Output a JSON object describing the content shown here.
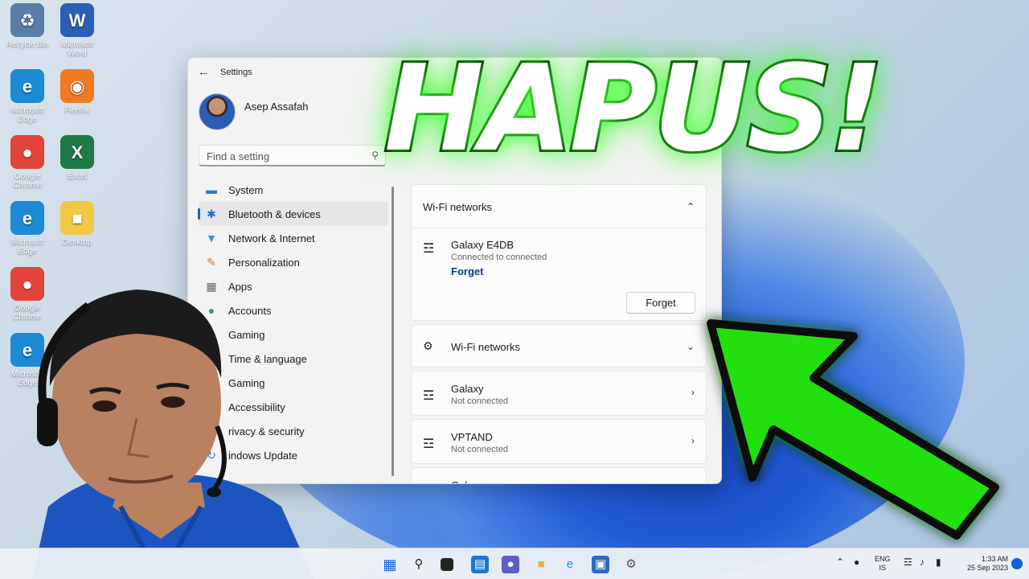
{
  "caption": "HAPUS!",
  "desktop": {
    "icons": [
      {
        "label": "Recycle Bin",
        "color": "#5a7da8",
        "glyph": "♻"
      },
      {
        "label": "Microsoft Edge",
        "color": "#1c8ad4",
        "glyph": "e"
      },
      {
        "label": "Google Chrome",
        "color": "#e0443a",
        "glyph": "●"
      },
      {
        "label": "Microsoft Edge",
        "color": "#1c8ad4",
        "glyph": "e"
      },
      {
        "label": "Google Chrome",
        "color": "#e0443a",
        "glyph": "●"
      },
      {
        "label": "Microsoft Edge",
        "color": "#1c8ad4",
        "glyph": "e"
      },
      {
        "label": "Microsoft Word",
        "color": "#2b5fb4",
        "glyph": "W"
      },
      {
        "label": "Firefox",
        "color": "#f07a1f",
        "glyph": "◉"
      },
      {
        "label": "Excel",
        "color": "#1e7a45",
        "glyph": "X"
      },
      {
        "label": "Desktop",
        "color": "#f2c744",
        "glyph": "■"
      }
    ]
  },
  "settings": {
    "title": "Settings",
    "user_name": "Asep Assafah",
    "search_placeholder": "Find a setting",
    "nav": [
      {
        "label": "System",
        "icon": "system-icon",
        "glyph": "▬",
        "color": "#2a7fcf"
      },
      {
        "label": "Bluetooth & devices",
        "icon": "bluetooth-icon",
        "glyph": "✱",
        "color": "#1e6fd6",
        "active": true
      },
      {
        "label": "Network & Internet",
        "icon": "network-icon",
        "glyph": "▼",
        "color": "#2a8fe0"
      },
      {
        "label": "Personalization",
        "icon": "brush-icon",
        "glyph": "✎",
        "color": "#c07830"
      },
      {
        "label": "Apps",
        "icon": "apps-icon",
        "glyph": "▦",
        "color": "#5a6470"
      },
      {
        "label": "Accounts",
        "icon": "accounts-icon",
        "glyph": "●",
        "color": "#2fa07a"
      },
      {
        "label": "Gaming",
        "icon": "gaming-icon",
        "glyph": "◈",
        "color": "#3a78c8"
      },
      {
        "label": "Time & language",
        "icon": "clock-icon",
        "glyph": "◔",
        "color": "#3a78c8"
      },
      {
        "label": "Gaming",
        "icon": "gaming-icon",
        "glyph": "◈",
        "color": "#3a78c8"
      },
      {
        "label": "Accessibility",
        "icon": "accessibility-icon",
        "glyph": "★",
        "color": "#3a78c8"
      },
      {
        "label": "rivacy & security",
        "icon": "shield-icon",
        "glyph": "◆",
        "color": "#555"
      },
      {
        "label": "indows Update",
        "icon": "update-icon",
        "glyph": "↻",
        "color": "#2a7fcf"
      }
    ]
  },
  "wifi": {
    "header": "Wi-Fi networks",
    "connected": {
      "name": "Galaxy E4DB",
      "status": "Connected to connected",
      "link": "Forget",
      "button": "Forget"
    },
    "section_header": "Wi-Fi networks",
    "networks": [
      {
        "name": "Galaxy",
        "status": "Not connected"
      },
      {
        "name": "VPTAND",
        "status": "Not connected"
      },
      {
        "name": "Galaxy",
        "status": ""
      }
    ]
  },
  "taskbar": {
    "lang_top": "ENG",
    "lang_bottom": "IS",
    "time": "1:33 AM",
    "date": "25 Sep 2023"
  }
}
